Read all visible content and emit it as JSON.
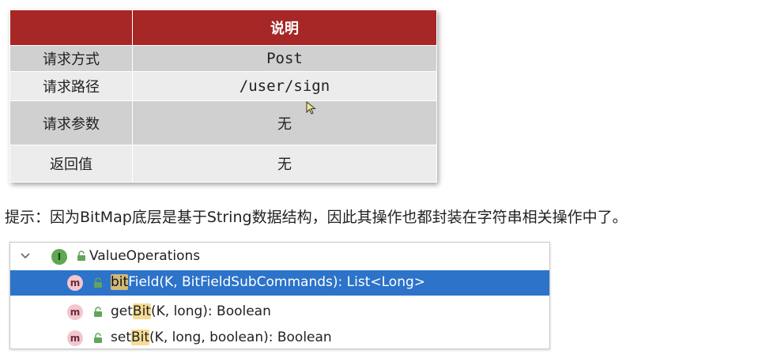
{
  "table": {
    "header": [
      "",
      "说明"
    ],
    "rows": [
      {
        "key": "请求方式",
        "value": "Post"
      },
      {
        "key": "请求路径",
        "value": "/user/sign"
      },
      {
        "key": "请求参数",
        "value": "无"
      },
      {
        "key": "返回值",
        "value": "无"
      }
    ]
  },
  "hint": "提示：因为BitMap底层是基于String数据结构，因此其操作也都封装在字符串相关操作中了。",
  "popup": {
    "parent": {
      "icon": "interface-icon",
      "badge": "I",
      "name": "ValueOperations"
    },
    "items": [
      {
        "badge": "m",
        "match": "bit",
        "rest": "Field(K, BitFieldSubCommands): List<Long>",
        "prefix": "",
        "selected": true
      },
      {
        "badge": "m",
        "prefix": "get",
        "match": "Bit",
        "rest": "(K, long): Boolean",
        "selected": false
      },
      {
        "badge": "m",
        "prefix": "set",
        "match": "Bit",
        "rest": "(K, long, boolean): Boolean",
        "selected": false
      }
    ]
  },
  "colors": {
    "table_header": "#a72626",
    "selection": "#2c73c9",
    "match_highlight": "#f5dc92"
  }
}
